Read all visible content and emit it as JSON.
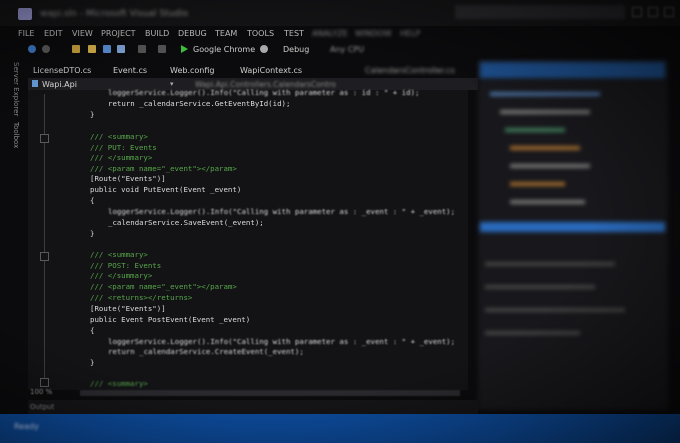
{
  "title_bar": {
    "window_title": "wapi.sln - Microsoft Visual Studio",
    "window_title_blurred": "wapi.sln - Microsoft Visual Studio"
  },
  "menu": {
    "items": [
      "FILE",
      "EDIT",
      "VIEW",
      "PROJECT",
      "BUILD",
      "DEBUG",
      "TEAM",
      "TOOLS",
      "TEST",
      "ANALYZE",
      "WINDOW",
      "HELP"
    ]
  },
  "toolbar": {
    "run_target": "Google Chrome",
    "configuration": "Debug",
    "platform": "Any CPU"
  },
  "side_strip": {
    "server_explorer": "Server Explorer",
    "toolbox": "Toolbox"
  },
  "tabs": [
    "LicenseDTO.cs",
    "Event.cs",
    "Web.config",
    "WapiContext.cs",
    "CalendarsController.cs"
  ],
  "nav": {
    "file": "Wapi.Api",
    "member": "Wapi.Api.Controllers.CalendarsContro"
  },
  "code": {
    "l1": "loggerService.Logger().Info(\"Calling with parameter as : id : \" + id);",
    "l2": "return _calendarService.GetEventById(id);",
    "l3": "}",
    "l4": "/// <summary>",
    "l5": "/// PUT: Events",
    "l6": "/// </summary>",
    "l7": "/// <param name=\"_event\"></param>",
    "l8": "[Route(\"Events\")]",
    "l9": "public void PutEvent(Event _event)",
    "l10": "{",
    "l11": "loggerService.Logger().Info(\"Calling with parameter as : _event : \" + _event);",
    "l12": "_calendarService.SaveEvent(_event);",
    "l13": "}",
    "l14": "/// <summary>",
    "l15": "/// POST: Events",
    "l16": "/// </summary>",
    "l17": "/// <param name=\"_event\"></param>",
    "l18": "/// <returns></returns>",
    "l19": "[Route(\"Events\")]",
    "l20": "public Event PostEvent(Event _event)",
    "l21": "{",
    "l22": "loggerService.Logger().Info(\"Calling with parameter as : _event : \" + _event);",
    "l23": "return _calendarService.CreateEvent(_event);",
    "l24": "}",
    "l25": "/// <summary>"
  },
  "zoom": "100 %",
  "output_label": "Output",
  "status": "Ready",
  "colors": {
    "statusbar": "#0d4ea2",
    "comment": "#57a64a",
    "keyword": "#569cd6",
    "type": "#4ec9b0",
    "string": "#d69d85"
  }
}
